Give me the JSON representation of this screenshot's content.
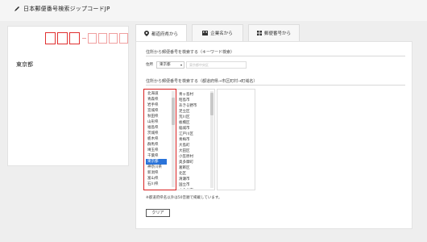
{
  "header": {
    "title": "日本郵便番号検索ジップコードJP"
  },
  "result": {
    "prefecture": "東京都"
  },
  "tabs": [
    {
      "label": "都道府県から",
      "icon": "map-pin-icon"
    },
    {
      "label": "企業名から",
      "icon": "building-icon"
    },
    {
      "label": "郵便番号から",
      "icon": "grid-icon"
    }
  ],
  "keyword_search": {
    "title": "住所から郵便番号を検索する（キーワード検索）",
    "label": "住所",
    "selected_prefecture": "東京都",
    "placeholder": "東京都中央区"
  },
  "list_search": {
    "title": "住所から郵便番号を検索する（都道府県→市区町村→町域名）"
  },
  "prefectures": [
    "北海道",
    "青森県",
    "岩手県",
    "宮城県",
    "秋田県",
    "山形県",
    "福島県",
    "茨城県",
    "栃木県",
    "群馬県",
    "埼玉県",
    "千葉県",
    "東京都",
    "神奈川県",
    "新潟県",
    "富山県",
    "石川県"
  ],
  "selected_prefecture_index": 12,
  "cities": [
    "青ヶ島村",
    "昭島市",
    "あきる野市",
    "足立区",
    "荒川区",
    "板橋区",
    "稲城市",
    "江戸川区",
    "青梅市",
    "大島町",
    "大田区",
    "小笠原村",
    "奥多摩町",
    "葛飾区",
    "北区",
    "清瀬市",
    "国立市",
    "小金井市",
    "国分寺市"
  ],
  "note": "※都道府県名以外は50音順で掲載しています。",
  "clear_label": "クリア"
}
